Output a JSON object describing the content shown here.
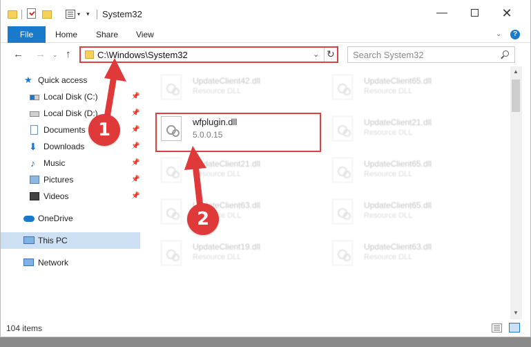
{
  "window": {
    "title": "System32"
  },
  "quick_access_toolbar": {
    "icons": [
      "folder-icon",
      "properties-check-icon",
      "new-folder-icon",
      "properties-icon",
      "customize-dropdown-icon"
    ]
  },
  "ribbon": {
    "tabs": [
      "File",
      "Home",
      "Share",
      "View"
    ],
    "help_label": "?"
  },
  "nav": {
    "address": "C:\\Windows\\System32",
    "search_placeholder": "Search System32"
  },
  "sidebar": {
    "items": [
      {
        "label": "Quick access",
        "icon": "star-icon",
        "pinned": false
      },
      {
        "label": "Local Disk (C:)",
        "icon": "drive-c-icon",
        "pinned": true
      },
      {
        "label": "Local Disk (D:)",
        "icon": "drive-d-icon",
        "pinned": true
      },
      {
        "label": "Documents",
        "icon": "documents-icon",
        "pinned": true
      },
      {
        "label": "Downloads",
        "icon": "downloads-icon",
        "pinned": true
      },
      {
        "label": "Music",
        "icon": "music-icon",
        "pinned": true
      },
      {
        "label": "Pictures",
        "icon": "pictures-icon",
        "pinned": true
      },
      {
        "label": "Videos",
        "icon": "videos-icon",
        "pinned": true
      },
      {
        "label": "OneDrive",
        "icon": "onedrive-icon",
        "pinned": false
      },
      {
        "label": "This PC",
        "icon": "this-pc-icon",
        "pinned": false,
        "selected": true
      },
      {
        "label": "Network",
        "icon": "network-icon",
        "pinned": false
      }
    ]
  },
  "files": {
    "left_column": [
      {
        "name": "UpdateClient42.dll",
        "type": "Resource DLL"
      },
      {
        "name": "wfplugin.dll",
        "type": "5.0.0.15"
      },
      {
        "name": "UpdateClient21.dll",
        "type": "Resource DLL"
      },
      {
        "name": "UpdateClient63.dll",
        "type": "Resource DLL"
      },
      {
        "name": "UpdateClient19.dll",
        "type": "Resource DLL"
      }
    ],
    "right_column": [
      {
        "name": "UpdateClient65.dll",
        "type": "Resource DLL"
      },
      {
        "name": "UpdateClient21.dll",
        "type": "Resource DLL"
      },
      {
        "name": "UpdateClient65.dll",
        "type": "Resource DLL"
      },
      {
        "name": "UpdateClient65.dll",
        "type": "Resource DLL"
      },
      {
        "name": "UpdateClient63.dll",
        "type": "Resource DLL"
      }
    ]
  },
  "status": {
    "count": "104 items"
  },
  "annotations": {
    "step1": "1",
    "step2": "2",
    "color": "#e0393a"
  },
  "colors": {
    "accent": "#1979ca",
    "selection": "#cde0f3",
    "highlight_border": "#d94040"
  }
}
